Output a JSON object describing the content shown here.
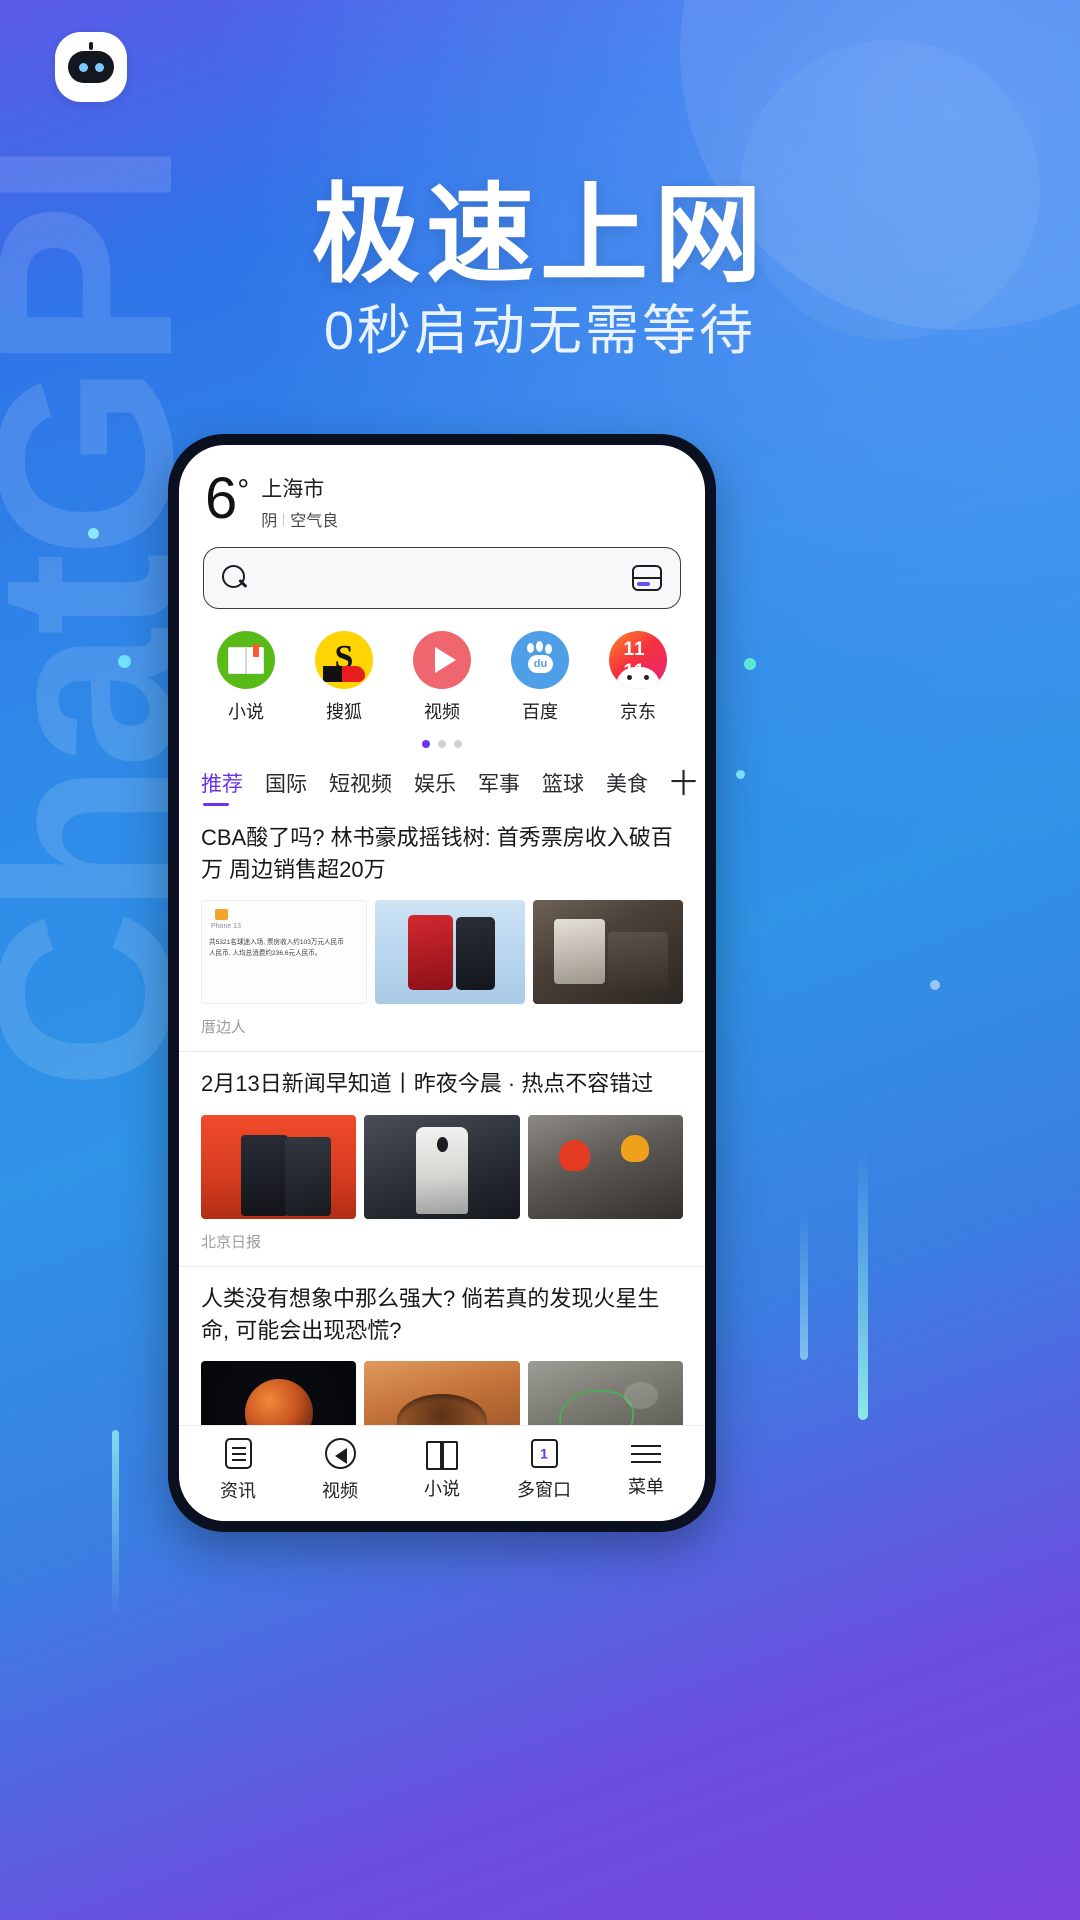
{
  "hero": {
    "title": "极速上网",
    "subtitle": "0秒启动无需等待",
    "logo_icon": "robot-logo-icon"
  },
  "phone": {
    "weather": {
      "temperature": "6",
      "degree_symbol": "°",
      "city": "上海市",
      "condition": "阴",
      "air_quality": "空气良"
    },
    "search": {
      "placeholder": "",
      "value": "",
      "search_icon": "search-icon",
      "multiwindow_icon": "window-switch-icon"
    },
    "shortcuts": [
      {
        "label": "小说",
        "icon": "novel-book-icon",
        "color": "#57ba16"
      },
      {
        "label": "搜狐",
        "icon": "sohu-logo-icon",
        "color": "#ffd400"
      },
      {
        "label": "视频",
        "icon": "video-play-icon",
        "color": "#f0666e"
      },
      {
        "label": "百度",
        "icon": "baidu-paw-icon",
        "color": "#4f9fe8"
      },
      {
        "label": "京东",
        "icon": "jd-dog-icon",
        "color": "#f5313f"
      }
    ],
    "pager": {
      "total": 3,
      "active_index": 0
    },
    "news_tabs": [
      {
        "label": "推荐",
        "active": true
      },
      {
        "label": "国际",
        "active": false
      },
      {
        "label": "短视频",
        "active": false
      },
      {
        "label": "娱乐",
        "active": false
      },
      {
        "label": "军事",
        "active": false
      },
      {
        "label": "篮球",
        "active": false
      },
      {
        "label": "美食",
        "active": false
      }
    ],
    "add_tab_label": "十",
    "active_tab_color": "#6b34e8",
    "feed": [
      {
        "title": "CBA酸了吗? 林书豪成摇钱树: 首秀票房收入破百万 周边销售超20万",
        "source": "厝边人",
        "thumb_caption_brand": "Phone 13",
        "thumb_caption_line1": "共5321名球迷入场, 票房收入约103万元人民币",
        "thumb_caption_line2": "人民币, 人均总消费约236.6元人民币。"
      },
      {
        "title": "2月13日新闻早知道丨昨夜今晨 · 热点不容错过",
        "source": "北京日报"
      },
      {
        "title": "人类没有想象中那么强大? 倘若真的发现火星生命, 可能会出现恐慌?",
        "source": ""
      }
    ],
    "bottom_nav": [
      {
        "label": "资讯",
        "icon": "news-document-icon",
        "badge": ""
      },
      {
        "label": "视频",
        "icon": "video-back-circle-icon",
        "badge": ""
      },
      {
        "label": "小说",
        "icon": "open-book-icon",
        "badge": ""
      },
      {
        "label": "多窗口",
        "icon": "multi-window-icon",
        "badge": "1"
      },
      {
        "label": "菜单",
        "icon": "hamburger-menu-icon",
        "badge": ""
      }
    ]
  },
  "watermark": "ChatGPI"
}
